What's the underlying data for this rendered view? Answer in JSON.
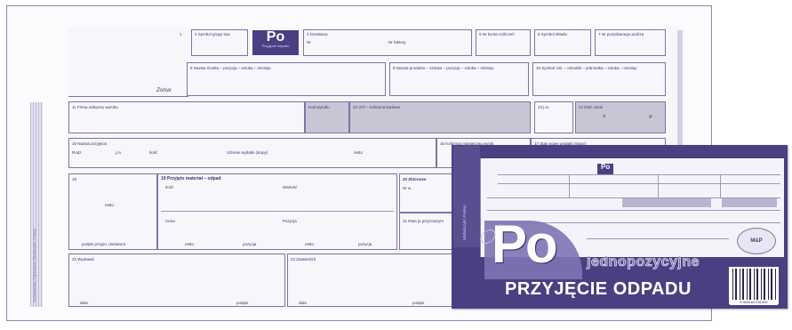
{
  "form_sheet": {
    "po_badge": {
      "big": "Po",
      "small": "Przyjęcie odpadu"
    },
    "zarlab": "Zorlux",
    "fields": {
      "f1": "1",
      "f2": "2  Symbol grupy tow.",
      "f4": "4  Dostawca",
      "f4_sub1": "Nr",
      "f4_sub2": "Nr faktury",
      "f5": "5  Nr konta rozliczeń",
      "f6": "6  Symbol składu",
      "f7": "7  Nr pozyskanego podrzę",
      "f8": "8  Nazwa środka – pozycja – sztuka – miesiąc",
      "f9": "9  Nazwa produktu – zestaw – pozycja – sztuka – miesiąc",
      "f10": "10  Symbol rob. – ośrodek – jednostka – sztuka – miesiąc",
      "f11": "11  Firma nabywcy wyrobu",
      "f11_sub": "Kod wyrobu",
      "f12": "12  VAT – kolumna kodowa",
      "f13": "13  j.m.",
      "f14": "14  Ilość sztuk",
      "f14_sub1": "zł",
      "f14_sub2": "gr",
      "f15": "15  Nazwa przyjęcia",
      "f15_sub1": "Rodz.",
      "f15_sub2": "j.m.",
      "f15_sub3": "Ilość",
      "f15_sub4": "Ulżenie wydatki (stopy)",
      "f15_sub5": "netto",
      "f16_top": "16  Kolumna miesięczna wynik",
      "f17": "17  Stan nowy wydatki (stopy)",
      "f18": "18",
      "f18_sub": "netto",
      "f19": "19  Przyjęto materiał – odpad",
      "f19_sub1": "Ilość",
      "f19_sub2": "Wartość",
      "f19_sub3": "Cena",
      "f19_sub4": "Pozycja",
      "f19_foot1": "netto",
      "f19_foot2": "pozycja",
      "f19_foot3": "netto",
      "f19_foot4": "pozycja",
      "f20": "20  Zbiorowo",
      "f20_sub": "Nr w",
      "f21": "21  Rata je przyznanym",
      "f18_foot": "podpis przyjm. dostawca",
      "f22": "22  Wydawał",
      "f22_foot1": "data",
      "f22_foot2": "podpis",
      "f23": "23  Zatwierdził",
      "f23_foot1": "data",
      "f23_foot2": "podpis"
    },
    "spine_text": "Wydawnictwo Papiernicze Michalczyk i Prokop"
  },
  "cover": {
    "big_po": "Po",
    "subtitle": "jednopozycyjne",
    "title": "PRZYJĘCIE ODPADU",
    "side_text": "Michalczyk i Prokop",
    "seal_text": "M&P",
    "mini_po": "Po",
    "barcode_number": "5 905184 031095"
  },
  "colors": {
    "brand": "#4b3f82",
    "accent": "#7e73b3",
    "line": "#7a74a8"
  }
}
